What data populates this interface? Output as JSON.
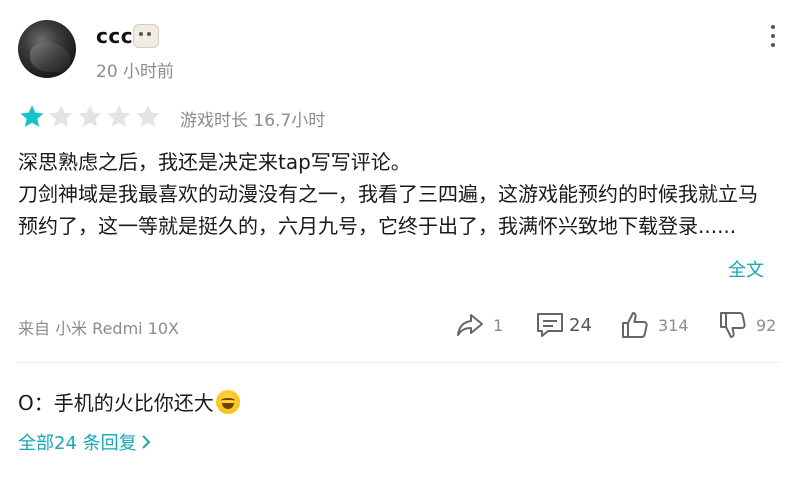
{
  "user": {
    "name": "ccc",
    "posted": "20 小时前"
  },
  "rating": {
    "filled": 1,
    "total": 5,
    "playtime": "游戏时长 16.7小时"
  },
  "review": {
    "line1": "深思熟虑之后，我还是决定来tap写写评论。",
    "line2": "刀剑神域是我最喜欢的动漫没有之一，我看了三四遍，这游戏能预约的时候我就立马预约了，这一等就是挺久的，六月九号，它终于出了，我满怀兴致地下载登录......",
    "expand": "全文"
  },
  "footer": {
    "device": "来自 小米 Redmi 10X",
    "shares": "1",
    "comments": "24",
    "likes": "314",
    "dislikes": "92"
  },
  "reply": {
    "text": "O：手机的火比你还大",
    "all": "全部24 条回复"
  },
  "colors": {
    "accent": "#13a9b3",
    "star_filled": "#16c3c8",
    "star_empty": "#e3e3e3",
    "muted": "#8c8c8c"
  }
}
